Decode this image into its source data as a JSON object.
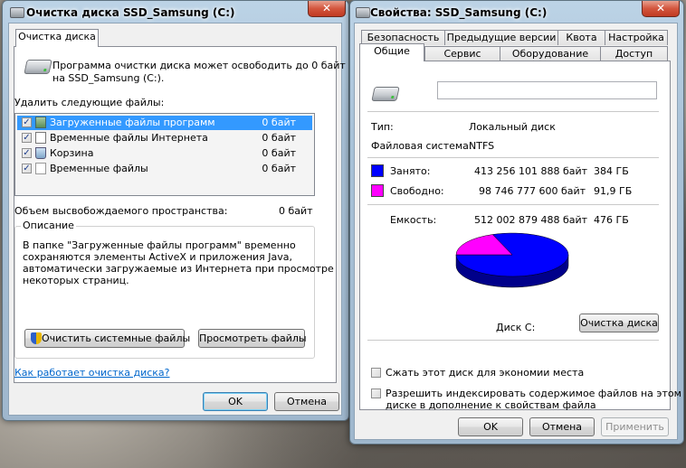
{
  "cleanup": {
    "title": "Очистка диска SSD_Samsung (C:)",
    "close": "✕",
    "tab": "Очистка диска",
    "intro_line1": "Программа очистки диска может освободить до 0 байт",
    "intro_line2": "на SSD_Samsung (C:).",
    "delete_label": "Удалить следующие файлы:",
    "files": [
      {
        "name": "Загруженные файлы программ",
        "size": "0 байт",
        "checked": "✓"
      },
      {
        "name": "Временные файлы Интернета",
        "size": "0 байт",
        "checked": "✓"
      },
      {
        "name": "Корзина",
        "size": "0 байт",
        "checked": "✓"
      },
      {
        "name": "Временные файлы",
        "size": "0 байт",
        "checked": "✓"
      }
    ],
    "freed_label": "Объем высвобождаемого пространства:",
    "freed_value": "0 байт",
    "desc_title": "Описание",
    "desc_lines": [
      "В папке \"Загруженные файлы программ\" временно",
      "сохраняются элементы ActiveX и приложения Java,",
      "автоматически загружаемые из Интернета при просмотре",
      "некоторых страниц."
    ],
    "clean_system_btn": "Очистить системные файлы",
    "view_files_btn": "Просмотреть файлы",
    "help_link": "Как работает очистка диска?",
    "ok": "OK",
    "cancel": "Отмена"
  },
  "props": {
    "title": "Свойства: SSD_Samsung (C:)",
    "close": "✕",
    "tabs_row1": [
      "Безопасность",
      "Предыдущие версии",
      "Квота",
      "Настройка"
    ],
    "tabs_row2": [
      "Общие",
      "Сервис",
      "Оборудование",
      "Доступ"
    ],
    "name_value": "",
    "type_label": "Тип:",
    "type_value": "Локальный диск",
    "fs_label": "Файловая система:",
    "fs_value": "NTFS",
    "used_label": "Занято:",
    "used_bytes": "413 256 101 888 байт",
    "used_gb": "384 ГБ",
    "free_label": "Свободно:",
    "free_bytes": "98 746 777 600 байт",
    "free_gb": "91,9 ГБ",
    "cap_label": "Емкость:",
    "cap_bytes": "512 002 879 488 байт",
    "cap_gb": "476 ГБ",
    "disk_label": "Диск C:",
    "cleanup_btn": "Очистка диска",
    "compress_label": "Сжать этот диск для экономии места",
    "index_line1": "Разрешить индексировать содержимое файлов на этом",
    "index_line2": "диске в дополнение к свойствам файла",
    "ok": "OK",
    "cancel": "Отмена",
    "apply": "Применить",
    "colors": {
      "used": "#0000ff",
      "free": "#ff00ff"
    },
    "used_fraction": 0.807
  }
}
